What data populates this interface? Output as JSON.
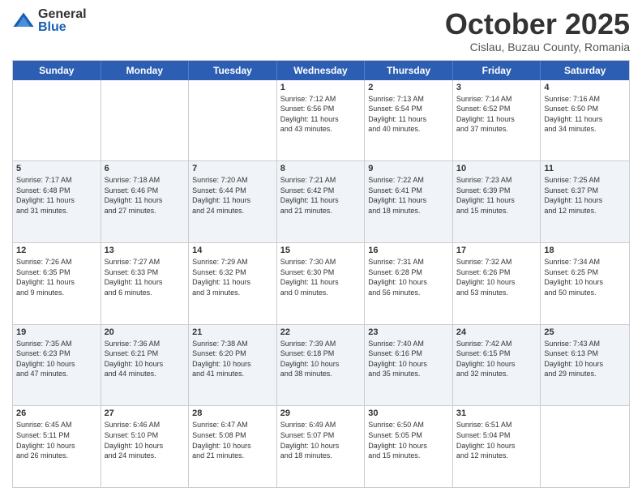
{
  "header": {
    "logo": {
      "general": "General",
      "blue": "Blue"
    },
    "title": "October 2025",
    "subtitle": "Cislau, Buzau County, Romania"
  },
  "days": [
    "Sunday",
    "Monday",
    "Tuesday",
    "Wednesday",
    "Thursday",
    "Friday",
    "Saturday"
  ],
  "rows": [
    [
      {
        "day": "",
        "text": ""
      },
      {
        "day": "",
        "text": ""
      },
      {
        "day": "",
        "text": ""
      },
      {
        "day": "1",
        "text": "Sunrise: 7:12 AM\nSunset: 6:56 PM\nDaylight: 11 hours\nand 43 minutes."
      },
      {
        "day": "2",
        "text": "Sunrise: 7:13 AM\nSunset: 6:54 PM\nDaylight: 11 hours\nand 40 minutes."
      },
      {
        "day": "3",
        "text": "Sunrise: 7:14 AM\nSunset: 6:52 PM\nDaylight: 11 hours\nand 37 minutes."
      },
      {
        "day": "4",
        "text": "Sunrise: 7:16 AM\nSunset: 6:50 PM\nDaylight: 11 hours\nand 34 minutes."
      }
    ],
    [
      {
        "day": "5",
        "text": "Sunrise: 7:17 AM\nSunset: 6:48 PM\nDaylight: 11 hours\nand 31 minutes."
      },
      {
        "day": "6",
        "text": "Sunrise: 7:18 AM\nSunset: 6:46 PM\nDaylight: 11 hours\nand 27 minutes."
      },
      {
        "day": "7",
        "text": "Sunrise: 7:20 AM\nSunset: 6:44 PM\nDaylight: 11 hours\nand 24 minutes."
      },
      {
        "day": "8",
        "text": "Sunrise: 7:21 AM\nSunset: 6:42 PM\nDaylight: 11 hours\nand 21 minutes."
      },
      {
        "day": "9",
        "text": "Sunrise: 7:22 AM\nSunset: 6:41 PM\nDaylight: 11 hours\nand 18 minutes."
      },
      {
        "day": "10",
        "text": "Sunrise: 7:23 AM\nSunset: 6:39 PM\nDaylight: 11 hours\nand 15 minutes."
      },
      {
        "day": "11",
        "text": "Sunrise: 7:25 AM\nSunset: 6:37 PM\nDaylight: 11 hours\nand 12 minutes."
      }
    ],
    [
      {
        "day": "12",
        "text": "Sunrise: 7:26 AM\nSunset: 6:35 PM\nDaylight: 11 hours\nand 9 minutes."
      },
      {
        "day": "13",
        "text": "Sunrise: 7:27 AM\nSunset: 6:33 PM\nDaylight: 11 hours\nand 6 minutes."
      },
      {
        "day": "14",
        "text": "Sunrise: 7:29 AM\nSunset: 6:32 PM\nDaylight: 11 hours\nand 3 minutes."
      },
      {
        "day": "15",
        "text": "Sunrise: 7:30 AM\nSunset: 6:30 PM\nDaylight: 11 hours\nand 0 minutes."
      },
      {
        "day": "16",
        "text": "Sunrise: 7:31 AM\nSunset: 6:28 PM\nDaylight: 10 hours\nand 56 minutes."
      },
      {
        "day": "17",
        "text": "Sunrise: 7:32 AM\nSunset: 6:26 PM\nDaylight: 10 hours\nand 53 minutes."
      },
      {
        "day": "18",
        "text": "Sunrise: 7:34 AM\nSunset: 6:25 PM\nDaylight: 10 hours\nand 50 minutes."
      }
    ],
    [
      {
        "day": "19",
        "text": "Sunrise: 7:35 AM\nSunset: 6:23 PM\nDaylight: 10 hours\nand 47 minutes."
      },
      {
        "day": "20",
        "text": "Sunrise: 7:36 AM\nSunset: 6:21 PM\nDaylight: 10 hours\nand 44 minutes."
      },
      {
        "day": "21",
        "text": "Sunrise: 7:38 AM\nSunset: 6:20 PM\nDaylight: 10 hours\nand 41 minutes."
      },
      {
        "day": "22",
        "text": "Sunrise: 7:39 AM\nSunset: 6:18 PM\nDaylight: 10 hours\nand 38 minutes."
      },
      {
        "day": "23",
        "text": "Sunrise: 7:40 AM\nSunset: 6:16 PM\nDaylight: 10 hours\nand 35 minutes."
      },
      {
        "day": "24",
        "text": "Sunrise: 7:42 AM\nSunset: 6:15 PM\nDaylight: 10 hours\nand 32 minutes."
      },
      {
        "day": "25",
        "text": "Sunrise: 7:43 AM\nSunset: 6:13 PM\nDaylight: 10 hours\nand 29 minutes."
      }
    ],
    [
      {
        "day": "26",
        "text": "Sunrise: 6:45 AM\nSunset: 5:11 PM\nDaylight: 10 hours\nand 26 minutes."
      },
      {
        "day": "27",
        "text": "Sunrise: 6:46 AM\nSunset: 5:10 PM\nDaylight: 10 hours\nand 24 minutes."
      },
      {
        "day": "28",
        "text": "Sunrise: 6:47 AM\nSunset: 5:08 PM\nDaylight: 10 hours\nand 21 minutes."
      },
      {
        "day": "29",
        "text": "Sunrise: 6:49 AM\nSunset: 5:07 PM\nDaylight: 10 hours\nand 18 minutes."
      },
      {
        "day": "30",
        "text": "Sunrise: 6:50 AM\nSunset: 5:05 PM\nDaylight: 10 hours\nand 15 minutes."
      },
      {
        "day": "31",
        "text": "Sunrise: 6:51 AM\nSunset: 5:04 PM\nDaylight: 10 hours\nand 12 minutes."
      },
      {
        "day": "",
        "text": ""
      }
    ]
  ]
}
